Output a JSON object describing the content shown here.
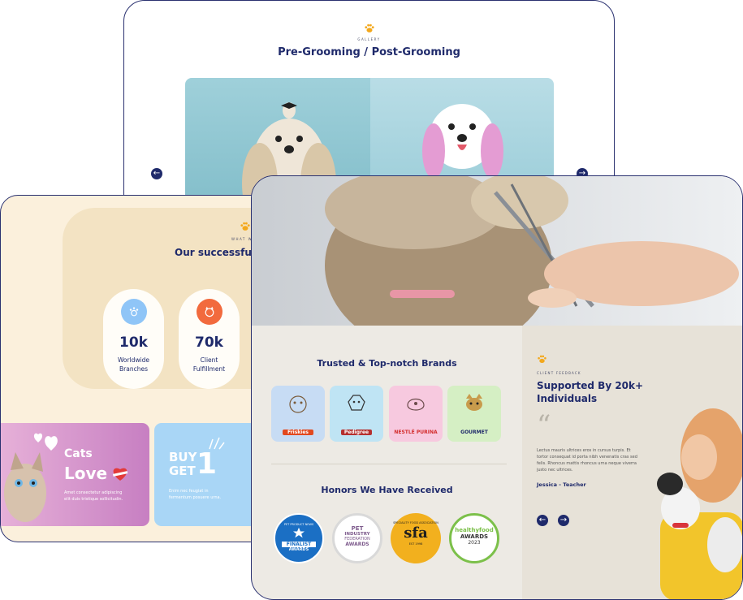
{
  "gallery": {
    "kicker": "GALLERY",
    "title": "Pre-Grooming / Post-Grooming",
    "prev_arrow": "←",
    "next_arrow": "→"
  },
  "stats": {
    "kicker": "WHAT WE",
    "title": "Our successful",
    "items": [
      {
        "icon": "paw-outline-icon",
        "value": "10k",
        "label_line1": "Worldwide",
        "label_line2": "Branches",
        "color": "#8fc5f7"
      },
      {
        "icon": "dog-face-icon",
        "value": "70k",
        "label_line1": "Client",
        "label_line2": "Fulfillment",
        "color": "#f26a3d"
      }
    ]
  },
  "promos": {
    "cats": {
      "line1": "Cats",
      "line2": "Love",
      "body_line1": "Amet consectetur adipiscing",
      "body_line2": "elit duis tristique sollicitudin."
    },
    "buy": {
      "line1": "BUY",
      "line2": "GET",
      "big": "1",
      "body_line1": "Enim nec feugiat in",
      "body_line2": "fermentum posuere urna."
    }
  },
  "brands": {
    "title": "Trusted & Top-notch Brands",
    "items": [
      {
        "name": "Friskies",
        "bg": "#c7dcf4"
      },
      {
        "name": "Pedigree",
        "bg": "#bfe4f4"
      },
      {
        "name": "NESTLÉ PURINA",
        "bg": "#f7c9df"
      },
      {
        "name": "GOURMET",
        "bg": "#d5efc4"
      }
    ]
  },
  "honors": {
    "title": "Honors We Have Received",
    "awards": [
      {
        "line1": "PET PRODUCT NEWS",
        "line2": "FINALIST",
        "line3": "AWARDS",
        "bg": "#1b6fc4"
      },
      {
        "line1": "PET",
        "line2": "INDUSTRY",
        "line3": "FEDERATION",
        "line4": "AWARDS",
        "bg": "#ffffff"
      },
      {
        "line1": "SPECIALITY FOOD ASSOCIATION",
        "line2": "sfa",
        "line3": "EST 1998",
        "bg": "#f2b01e"
      },
      {
        "line1": "healthyfood",
        "line2": "AWARDS",
        "line3": "2023",
        "bg": "#ffffff"
      }
    ]
  },
  "testimonial": {
    "kicker": "CLIENT FEEDBACK",
    "title_line1": "Supported By 20k+",
    "title_line2": "Individuals",
    "quote_mark": "“",
    "body": "Lectus mauris ultrices eros in cursus turpis. Et tortor consequat id porta nibh venenatis cras sed felis. Rhoncus mattis rhoncus urna neque viverra justo nec ultrices.",
    "author": "Jessica - Teacher",
    "prev": "←",
    "next": "→"
  }
}
